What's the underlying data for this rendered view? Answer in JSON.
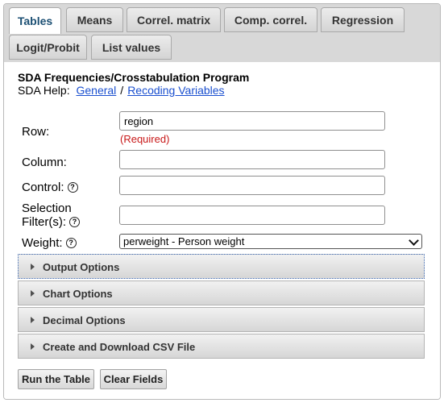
{
  "tabs": [
    {
      "label": "Tables",
      "active": true
    },
    {
      "label": "Means"
    },
    {
      "label": "Correl. matrix"
    },
    {
      "label": "Comp. correl."
    },
    {
      "label": "Regression"
    },
    {
      "label": "Logit/Probit"
    },
    {
      "label": "List values"
    }
  ],
  "program": {
    "title": "SDA Frequencies/Crosstabulation Program",
    "help_prefix": "SDA Help:",
    "help_general": "General",
    "help_separator": "/",
    "help_recoding": "Recoding Variables"
  },
  "form": {
    "row": {
      "label": "Row:",
      "value": "region",
      "required_note": "(Required)"
    },
    "column": {
      "label": "Column:",
      "value": ""
    },
    "control": {
      "label": "Control:",
      "value": ""
    },
    "selection": {
      "label_line1": "Selection",
      "label_line2": "Filter(s):",
      "value": ""
    },
    "weight": {
      "label": "Weight:",
      "selected": "perweight - Person weight"
    }
  },
  "sections": [
    {
      "label": "Output Options"
    },
    {
      "label": "Chart Options"
    },
    {
      "label": "Decimal Options"
    },
    {
      "label": "Create and Download CSV File"
    }
  ],
  "buttons": {
    "run": "Run the Table",
    "clear": "Clear Fields"
  },
  "icons": {
    "help": "?",
    "collapse": "triangle-right-icon",
    "dropdown": "chevron-down-icon"
  }
}
